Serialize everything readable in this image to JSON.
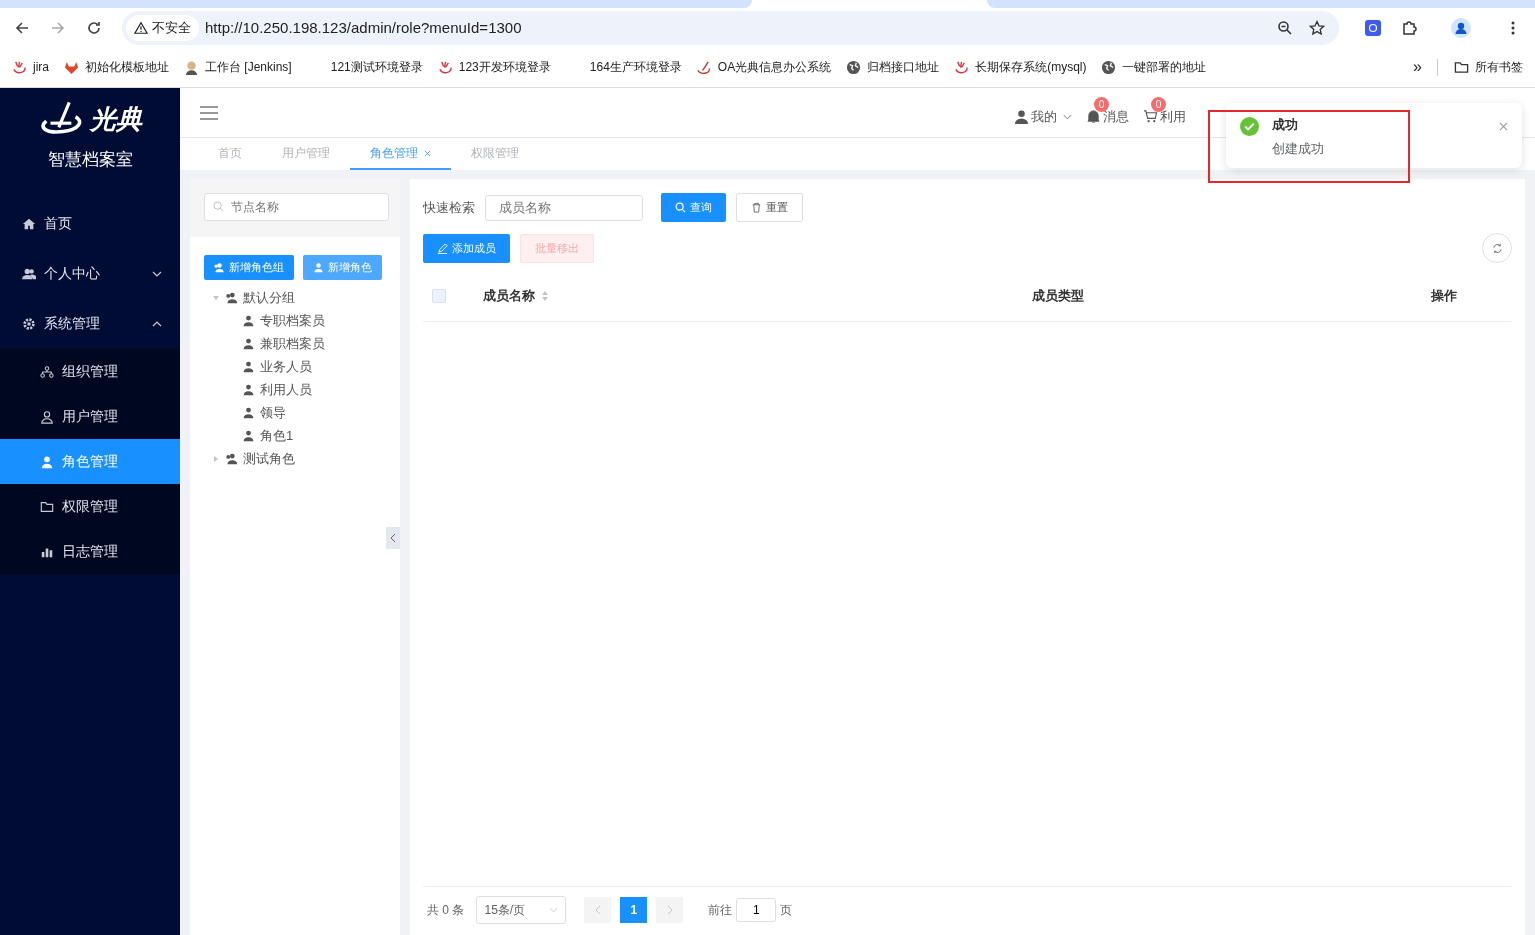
{
  "browser": {
    "security_label": "不安全",
    "url": "http://10.250.198.123/admin/role?menuId=1300",
    "bookmarks": [
      {
        "label": "jira",
        "kind": "swirl"
      },
      {
        "label": "初始化模板地址",
        "kind": "fox"
      },
      {
        "label": "工作台 [Jenkins]",
        "kind": "figure"
      },
      {
        "label": "121测试环境登录",
        "kind": "none"
      },
      {
        "label": "123开发环境登录",
        "kind": "swirl"
      },
      {
        "label": "164生产环境登录",
        "kind": "none"
      },
      {
        "label": "OA光典信息办公系统",
        "kind": "pen"
      },
      {
        "label": "归档接口地址",
        "kind": "globe"
      },
      {
        "label": "长期保存系统(mysql)",
        "kind": "swirl"
      },
      {
        "label": "一键部署的地址",
        "kind": "globe"
      }
    ],
    "more": "»",
    "folder": "所有书签"
  },
  "sidebar": {
    "logo": "光典",
    "app_name": "智慧档案室",
    "items": [
      {
        "label": "首页",
        "kind": "home",
        "selected": false
      },
      {
        "label": "个人中心",
        "kind": "users",
        "expanded": false,
        "selected": false
      },
      {
        "label": "系统管理",
        "kind": "gear",
        "expanded": true,
        "selected": false,
        "children": [
          {
            "label": "组织管理",
            "kind": "org",
            "selected": false
          },
          {
            "label": "用户管理",
            "kind": "user",
            "selected": false
          },
          {
            "label": "角色管理",
            "kind": "user",
            "selected": true
          },
          {
            "label": "权限管理",
            "kind": "folder",
            "selected": false
          },
          {
            "label": "日志管理",
            "kind": "chart",
            "selected": false
          }
        ]
      }
    ]
  },
  "header": {
    "user": "我的",
    "notices": [
      {
        "label": "消息",
        "badge": "0",
        "kind": "bell"
      },
      {
        "label": "利用",
        "badge": "0",
        "kind": "cart"
      }
    ]
  },
  "tabs": [
    {
      "label": "首页",
      "selected": false
    },
    {
      "label": "用户管理",
      "selected": false
    },
    {
      "label": "角色管理",
      "selected": true
    },
    {
      "label": "权限管理",
      "selected": false
    }
  ],
  "tree_panel": {
    "search_placeholder": "节点名称",
    "buttons": [
      {
        "label": "新增角色组",
        "kind": "group"
      },
      {
        "label": "新增角色",
        "kind": "single"
      }
    ],
    "tree": [
      {
        "label": "默认分组",
        "expanded": true,
        "children": [
          {
            "label": "专职档案员"
          },
          {
            "label": "兼职档案员"
          },
          {
            "label": "业务人员"
          },
          {
            "label": "利用人员"
          },
          {
            "label": "领导"
          },
          {
            "label": "角色1"
          }
        ]
      },
      {
        "label": "测试角色",
        "expanded": false
      }
    ]
  },
  "members": {
    "search_label": "快速检索",
    "search_placeholder": "成员名称",
    "query": "查询",
    "reset": "重置",
    "actions": [
      {
        "label": "添加成员",
        "disabled": false
      },
      {
        "label": "批量移出",
        "disabled": true
      }
    ],
    "select_all": {
      "checked": false
    },
    "columns": [
      {
        "label": "成员名称",
        "sortable": true
      },
      {
        "label": "成员类型",
        "sortable": false
      },
      {
        "label": "操作",
        "sortable": false
      }
    ],
    "pagination": {
      "total": "共 0 条",
      "page_size": "15条/页",
      "current": "1",
      "goto_label": "前往",
      "goto_value": "1",
      "page_unit": "页"
    }
  },
  "toast": {
    "title": "成功",
    "message": "创建成功",
    "highlighted": true
  }
}
